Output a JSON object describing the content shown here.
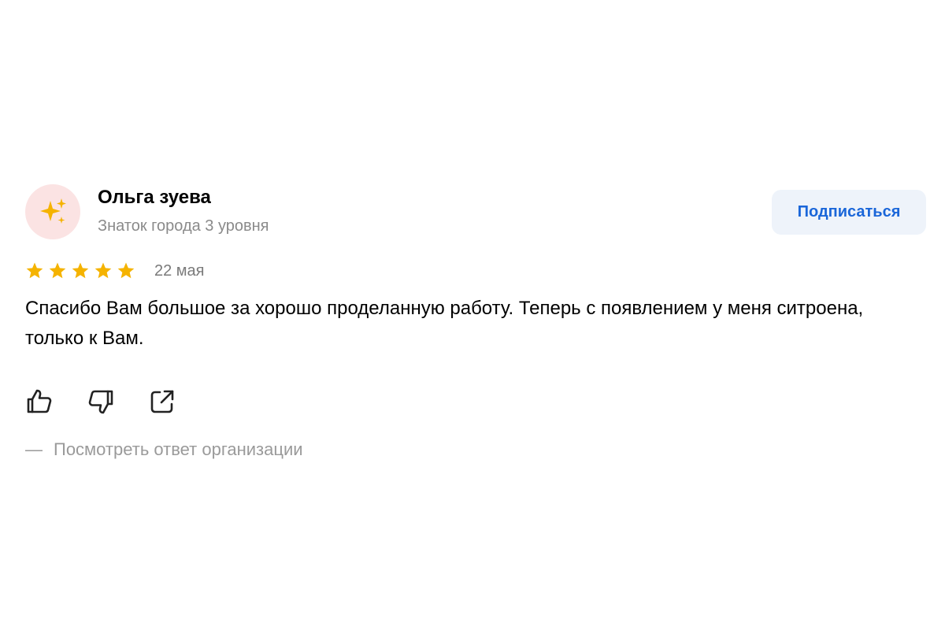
{
  "review": {
    "author": {
      "name": "Ольга зуева",
      "level": "Знаток города 3 уровня",
      "avatar_icon": "sparkles-icon",
      "avatar_bg": "#fbe3e3"
    },
    "subscribe_label": "Подписаться",
    "rating": 5,
    "rating_max": 5,
    "date": "22 мая",
    "text": "Спасибо Вам большое за хорошо проделанную работу. Теперь с появлением у меня ситроена, только к Вам.",
    "actions": [
      {
        "icon": "thumbs-up-icon"
      },
      {
        "icon": "thumbs-down-icon"
      },
      {
        "icon": "share-icon"
      }
    ],
    "reply_dash": "—",
    "reply_link": "Посмотреть ответ организации"
  },
  "colors": {
    "star": "#f5b300",
    "accent": "#1a66d9",
    "subscribe_bg": "#eef3fa",
    "muted_text": "#8a8a8a"
  }
}
